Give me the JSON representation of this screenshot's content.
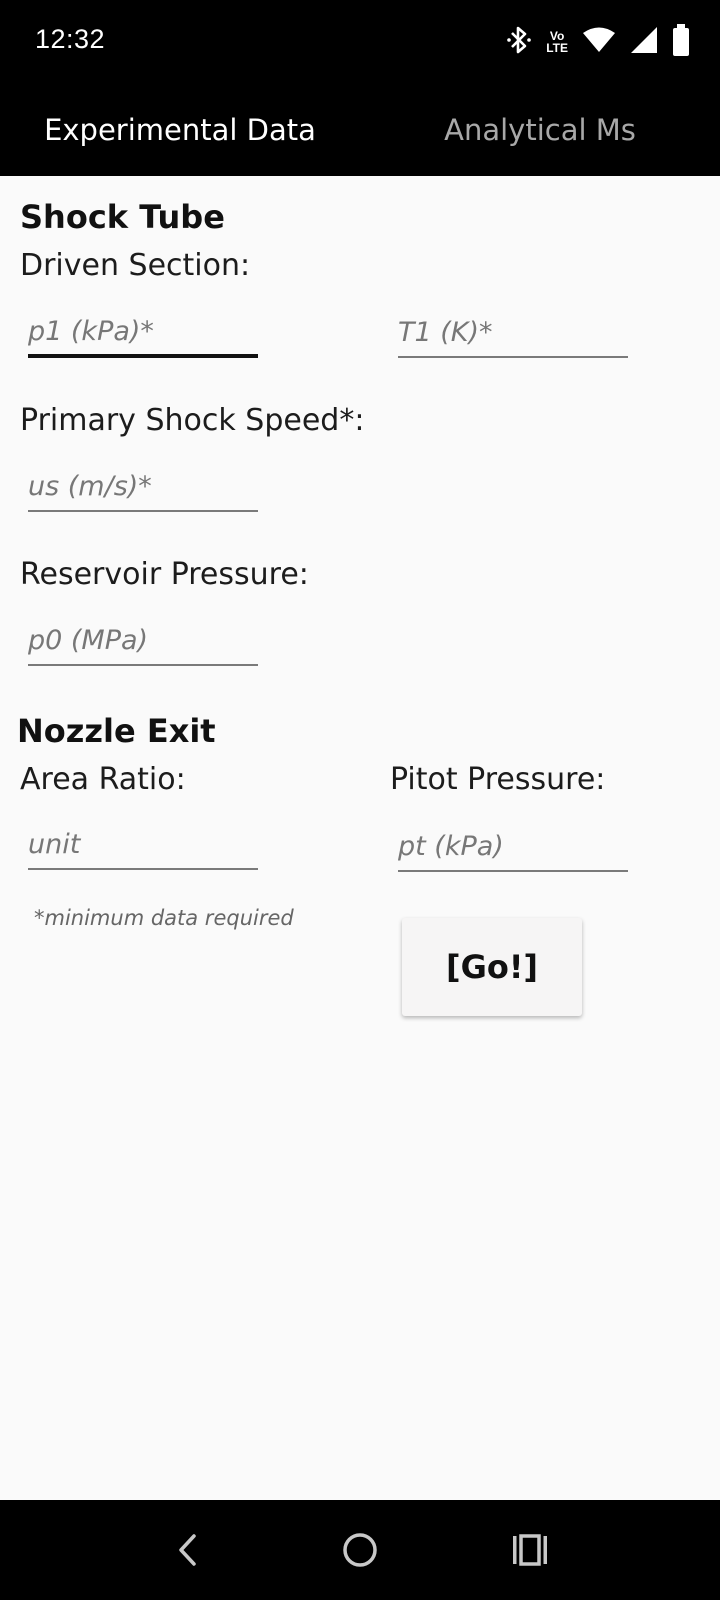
{
  "status_bar": {
    "time": "12:32",
    "icons": [
      "bluetooth-icon",
      "volte-icon",
      "wifi-icon",
      "signal-icon",
      "battery-icon"
    ],
    "volte_line1": "Vo",
    "volte_line2": "LTE"
  },
  "tabs": [
    {
      "label": "Experimental Data",
      "active": true
    },
    {
      "label": "Analytical Ms",
      "active": false
    }
  ],
  "shock_tube": {
    "heading": "Shock Tube",
    "driven_section_label": "Driven Section:",
    "p1_placeholder": "p1 (kPa)*",
    "t1_placeholder": "T1 (K)*",
    "shock_speed_label": "Primary Shock Speed*:",
    "us_placeholder": "us (m/s)*",
    "reservoir_label": "Reservoir Pressure:",
    "p0_placeholder": "p0 (MPa)"
  },
  "nozzle_exit": {
    "heading": "Nozzle Exit",
    "area_ratio_label": "Area Ratio:",
    "area_ratio_placeholder": "unit",
    "pitot_label": "Pitot Pressure:",
    "pitot_placeholder": "pt (kPa)"
  },
  "note": "*minimum data required",
  "go_button_label": "[Go!]",
  "nav_bar": {
    "icons": [
      "back-icon",
      "home-icon",
      "recents-icon"
    ]
  },
  "colors": {
    "bar_background": "#000000",
    "page_background": "#fafafa",
    "inactive_tab": "#a8a8a8",
    "underline": "#7a7a7a",
    "focused_underline": "#111111"
  }
}
